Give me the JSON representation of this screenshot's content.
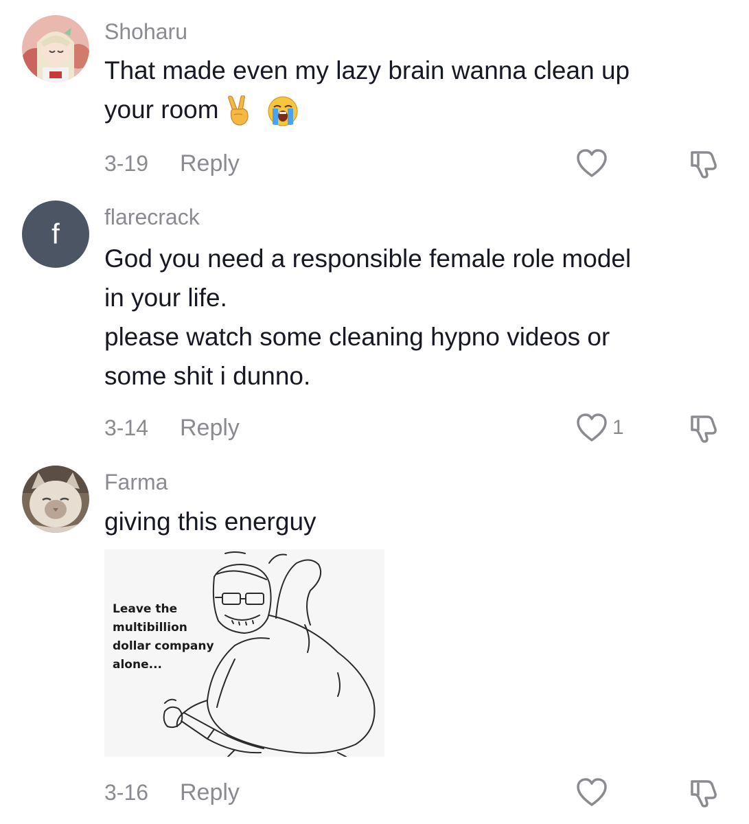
{
  "comments": [
    {
      "username": "Shoharu",
      "lines": [
        "That made even my lazy brain wanna clean up",
        "your room"
      ],
      "emojis": [
        "victory-hand-icon",
        "loudly-crying-face-icon"
      ],
      "date": "3-19",
      "reply_label": "Reply",
      "likes": ""
    },
    {
      "username": "flarecrack",
      "avatar_letter": "f",
      "lines": [
        "God you need a responsible female role model",
        "in your life.",
        "please watch some cleaning hypno videos or",
        "some shit i dunno."
      ],
      "date": "3-14",
      "reply_label": "Reply",
      "likes": "1"
    },
    {
      "username": "Farma",
      "lines": [
        "giving this energuy"
      ],
      "image_caption": [
        "Leave the",
        "multibillion",
        "dollar company",
        "alone..."
      ],
      "date": "3-16",
      "reply_label": "Reply",
      "likes": ""
    }
  ],
  "colors": {
    "text": "#161823",
    "secondary": "#8a8b91",
    "letter_avatar_bg": "#4b5563",
    "background": "#ffffff"
  },
  "icons": {
    "like": "heart-outline-icon",
    "dislike": "thumbs-down-outline-icon"
  }
}
